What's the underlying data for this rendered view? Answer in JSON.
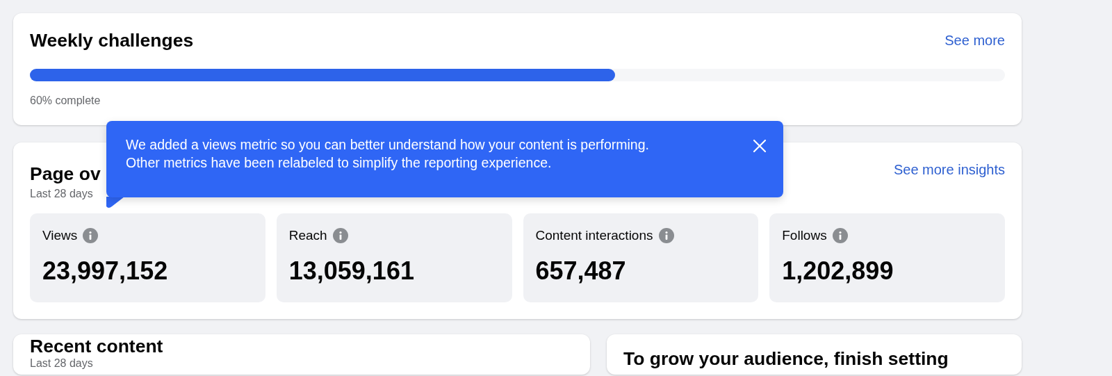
{
  "challenges": {
    "title": "Weekly challenges",
    "link": "See more",
    "level": 0.6,
    "progress_text": "60% complete"
  },
  "overview": {
    "title": "Page ov",
    "subtitle": "Last 28 days",
    "link": "See more insights",
    "metrics": [
      {
        "label": "Views",
        "value": "23,997,152"
      },
      {
        "label": "Reach",
        "value": "13,059,161"
      },
      {
        "label": "Content interactions",
        "value": "657,487"
      },
      {
        "label": "Follows",
        "value": "1,202,899"
      }
    ]
  },
  "tooltip": {
    "lines": [
      "We added a views metric so you can better understand how your content is performing.",
      "Other metrics have been relabeled to simplify the reporting experience."
    ]
  },
  "recent_content": {
    "title": "Recent content",
    "subtitle": "Last 28 days"
  },
  "grow_card": {
    "title": "To grow your audience, finish setting"
  }
}
